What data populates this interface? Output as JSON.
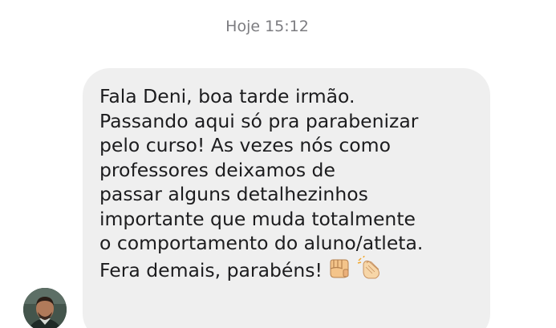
{
  "chat": {
    "timestamp": "Hoje 15:12",
    "message": {
      "lines": [
        "Fala Deni, boa tarde irmão.",
        "Passando aqui só pra parabenizar",
        "pelo curso! As vezes nós como",
        "professores deixamos de",
        "passar alguns detalhezinhos",
        "importante que muda totalmente",
        "o comportamento do aluno/atleta.",
        "Fera demais, parabéns!"
      ],
      "emojis": [
        "fist-bump-emoji",
        "clapping-hands-emoji"
      ]
    },
    "avatar_icon": "avatar"
  },
  "colors": {
    "background": "#ffffff",
    "bubble": "#efefef",
    "text": "#1c1c1e",
    "timestamp": "#7c7c80"
  }
}
